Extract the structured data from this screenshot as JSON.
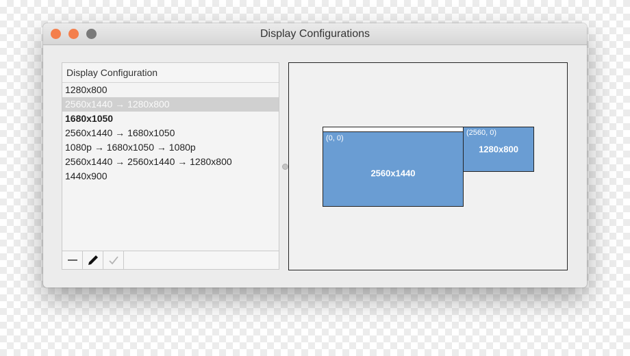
{
  "window": {
    "title": "Display Configurations",
    "traffic_lights": {
      "close_color": "#f47f4c",
      "minimize_color": "#f47f4c",
      "zoom_color": "#7a7a7a"
    }
  },
  "config_list": {
    "header": "Display Configuration",
    "items": [
      {
        "label": "1280x800",
        "selected": false,
        "bold": false
      },
      {
        "label": "2560x1440 → 1280x800",
        "selected": true,
        "bold": false
      },
      {
        "label": "1680x1050",
        "selected": false,
        "bold": true
      },
      {
        "label": "2560x1440 → 1680x1050",
        "selected": false,
        "bold": false
      },
      {
        "label": "1080p → 1680x1050 → 1080p",
        "selected": false,
        "bold": false
      },
      {
        "label": "2560x1440 → 2560x1440 → 1280x800",
        "selected": false,
        "bold": false
      },
      {
        "label": "1440x900",
        "selected": false,
        "bold": false
      }
    ],
    "toolbar": {
      "remove_icon": "minus-icon",
      "edit_icon": "pencil-icon",
      "apply_icon": "checkmark-icon"
    }
  },
  "arrangement": {
    "display_color": "#6a9dd3",
    "displays": [
      {
        "origin": "(0, 0)",
        "resolution": "2560x1440"
      },
      {
        "origin": "(2560, 0)",
        "resolution": "1280x800"
      }
    ]
  }
}
